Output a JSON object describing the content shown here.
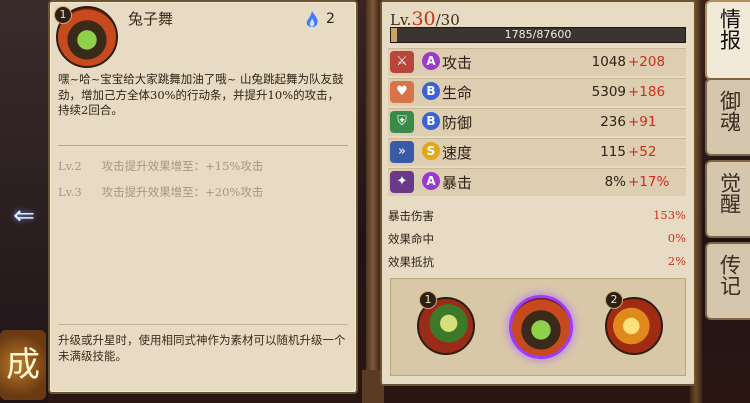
{
  "skill": {
    "badge": "1",
    "name": "兔子舞",
    "cost": "2",
    "description": "嘿~哈~宝宝给大家跳舞加油了哦~ 山兔跳起舞为队友鼓劲，增加己方全体30%的行动条，并提升10%的攻击，持续2回合。",
    "upgrades": [
      {
        "level": "Lv.2",
        "text": "攻击提升效果增至：+15%攻击"
      },
      {
        "level": "Lv.3",
        "text": "攻击提升效果增至：+20%攻击"
      }
    ],
    "note": "升级或升星时，使用相同式神作为素材可以随机升级一个未满级技能。"
  },
  "level": {
    "prefix": "Lv.",
    "current": "30",
    "max": "/30"
  },
  "exp": {
    "text": "1785/87600",
    "fill_fraction": 0.02
  },
  "stats": [
    {
      "grade": "A",
      "label": "攻击",
      "base": "1048",
      "bonus": "+208",
      "grade_color": "#9a3ad1",
      "icon": "attack-icon"
    },
    {
      "grade": "B",
      "label": "生命",
      "base": "5309",
      "bonus": "+186",
      "grade_color": "#3a63d6",
      "icon": "health-icon"
    },
    {
      "grade": "B",
      "label": "防御",
      "base": "236",
      "bonus": "+91",
      "grade_color": "#3a63d6",
      "icon": "defense-icon"
    },
    {
      "grade": "S",
      "label": "速度",
      "base": "115",
      "bonus": "+52",
      "grade_color": "#e0a81a",
      "icon": "speed-icon"
    },
    {
      "grade": "A",
      "label": "暴击",
      "base": "8%",
      "bonus": "+17%",
      "grade_color": "#9a3ad1",
      "icon": "crit-icon"
    }
  ],
  "sub_stats": [
    {
      "label": "暴击伤害",
      "value": "153%"
    },
    {
      "label": "效果命中",
      "value": "0%"
    },
    {
      "label": "效果抵抗",
      "value": "2%"
    }
  ],
  "skills_strip": [
    {
      "badge": "1",
      "icon": "skill-1-icon",
      "selected": false
    },
    {
      "badge": "",
      "icon": "skill-dance-icon",
      "selected": true
    },
    {
      "badge": "2",
      "icon": "skill-2-icon",
      "selected": false
    }
  ],
  "tabs": [
    {
      "label": "情报",
      "active": true
    },
    {
      "label": "御魂",
      "active": false
    },
    {
      "label": "觉醒",
      "active": false
    },
    {
      "label": "传记",
      "active": false
    }
  ],
  "bottom_seal": "成",
  "colors": {
    "accent_red": "#c63418",
    "parchment": "#e8dbc3"
  }
}
